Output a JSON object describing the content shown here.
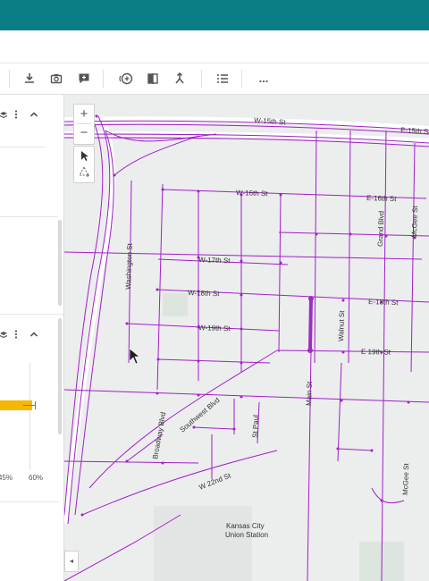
{
  "toolbar": {
    "icons": [
      "download-icon",
      "camera-icon",
      "comment-icon",
      "add-layer-icon",
      "compare-icon",
      "merge-icon",
      "list-icon",
      "more-icon"
    ],
    "more_label": "..."
  },
  "panel": {
    "axis_ticks": [
      "45%",
      "60%"
    ],
    "bar_color": "#f5b800",
    "section_icons": [
      "layers-icon",
      "more-vert-icon",
      "chevron-up-icon"
    ]
  },
  "map": {
    "streets": {
      "w15": "W-15th St",
      "e15": "E-15th St",
      "w16": "W-16th St",
      "e16": "E-16th St",
      "w17": "W-17th St",
      "w18": "W-18th St",
      "e18": "E-18th St",
      "w19": "W-19th St",
      "e19": "E 19th St",
      "w22": "W 22nd St",
      "washington": "Washington St",
      "broadway": "Broadway Blvd",
      "southwest": "Southwest Blvd",
      "stpaul": "St Paul",
      "main": "Main St",
      "walnut": "Walnut St",
      "grand": "Grand Blvd",
      "mcgee_upper": "McGee St",
      "mcgee_lower": "McGee St"
    },
    "landmark_line1": "Kansas City",
    "landmark_line2": "Union Station",
    "road_color": "#a020c8",
    "highlight_color": "#9b30c0"
  },
  "controls": {
    "zoom_in": "+",
    "zoom_out": "−",
    "collapse": "◂"
  }
}
